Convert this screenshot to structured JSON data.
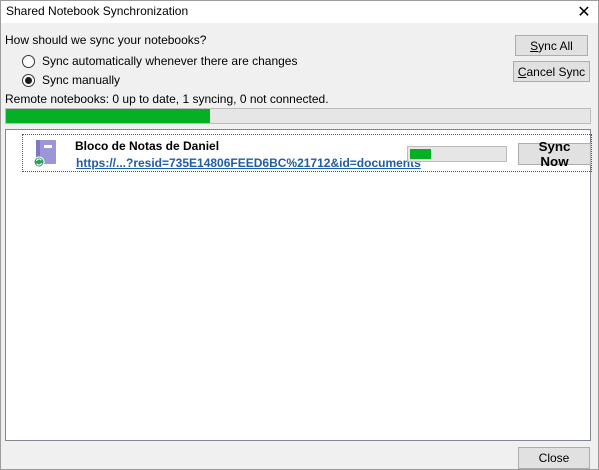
{
  "window": {
    "title": "Shared Notebook Synchronization"
  },
  "buttons": {
    "sync_all_mnemonic": "S",
    "sync_all_rest": "ync All",
    "cancel_sync_mnemonic": "C",
    "cancel_sync_rest": "ancel Sync",
    "close": "Close"
  },
  "options": {
    "question": "How should we sync your notebooks?",
    "auto_label": "Sync automatically whenever there are changes",
    "manual_label": "Sync manually",
    "selected": "manual"
  },
  "status": {
    "summary": "Remote notebooks: 0 up to date, 1 syncing, 0 not connected.",
    "overall_progress_percent": 35
  },
  "notebooks": [
    {
      "name": "Bloco de Notas de Daniel",
      "link": "https://...?resid=735E14806FEED6BC%21712&id=documents",
      "progress_percent": 25,
      "sync_now_label": "Sync Now"
    }
  ],
  "colors": {
    "progress_green": "#06b025",
    "link_blue": "#1f5da8",
    "notebook_icon_purple": "#9b96d8",
    "sync_badge_green": "#2e9d5a"
  },
  "icons": {
    "close": "close-icon",
    "notebook": "notebook-icon",
    "sync_badge": "sync-badge-icon"
  }
}
